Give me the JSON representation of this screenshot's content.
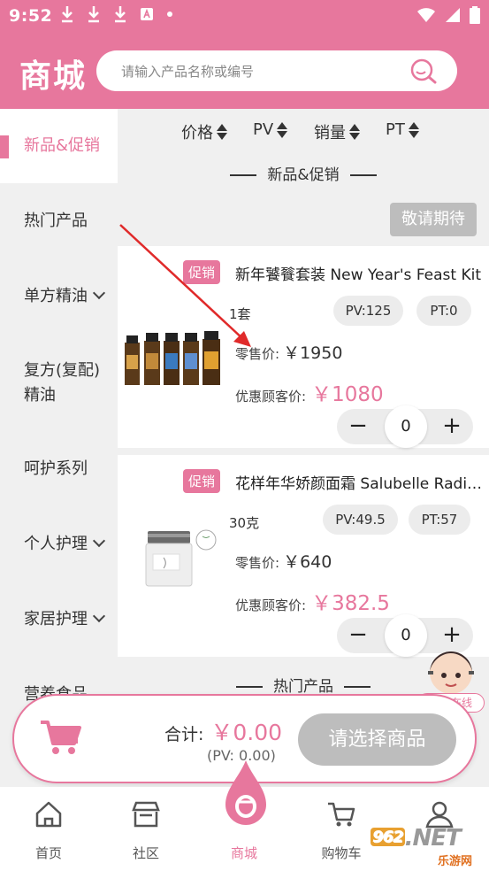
{
  "status_bar": {
    "time": "9:52"
  },
  "header": {
    "title": "商城",
    "search_placeholder": "请输入产品名称或编号"
  },
  "sidebar": {
    "items": [
      {
        "label": "新品&促销",
        "active": true
      },
      {
        "label": "热门产品"
      },
      {
        "label": "单方精油"
      },
      {
        "label": "复方(复配)",
        "label2": "精油"
      },
      {
        "label": "呵护系列"
      },
      {
        "label": "个人护理"
      },
      {
        "label": "家居护理"
      },
      {
        "label": "营养食品"
      }
    ]
  },
  "sort": {
    "price": "价格",
    "pv": "PV",
    "sales": "销量",
    "pt": "PT"
  },
  "section_new": "新品&促销",
  "coming_soon": "敬请期待",
  "products": [
    {
      "badge": "促销",
      "name": "新年饕餮套装 New Year's Feast Kit",
      "unit": "1套",
      "pv": "PV:125",
      "pt": "PT:0",
      "retail_label": "零售价:",
      "retail_price": "￥1950",
      "vip_label": "优惠顾客价:",
      "vip_price": "￥1080",
      "qty": "0"
    },
    {
      "badge": "促销",
      "name": "花样年华娇颜面霜 Salubelle Radiance Cream",
      "unit": "30克",
      "pv": "PV:49.5",
      "pt": "PT:57",
      "retail_label": "零售价:",
      "retail_price": "￥640",
      "vip_label": "优惠顾客价:",
      "vip_price": "￥382.5",
      "qty": "0"
    }
  ],
  "section_hot": "热门产品",
  "cart": {
    "total_label": "合计:",
    "total": "￥0.00",
    "pv": "(PV: 0.00)",
    "button": "请选择商品"
  },
  "support_label": "小多在线",
  "tabbar": {
    "home": "首页",
    "community": "社区",
    "mall": "商城",
    "cart": "购物车",
    "me": ""
  },
  "watermark": {
    "brand": "962",
    "domain": ".NET",
    "sub": "乐游网"
  },
  "colors": {
    "accent": "#e7779d",
    "disabled": "#bdbdbd"
  }
}
